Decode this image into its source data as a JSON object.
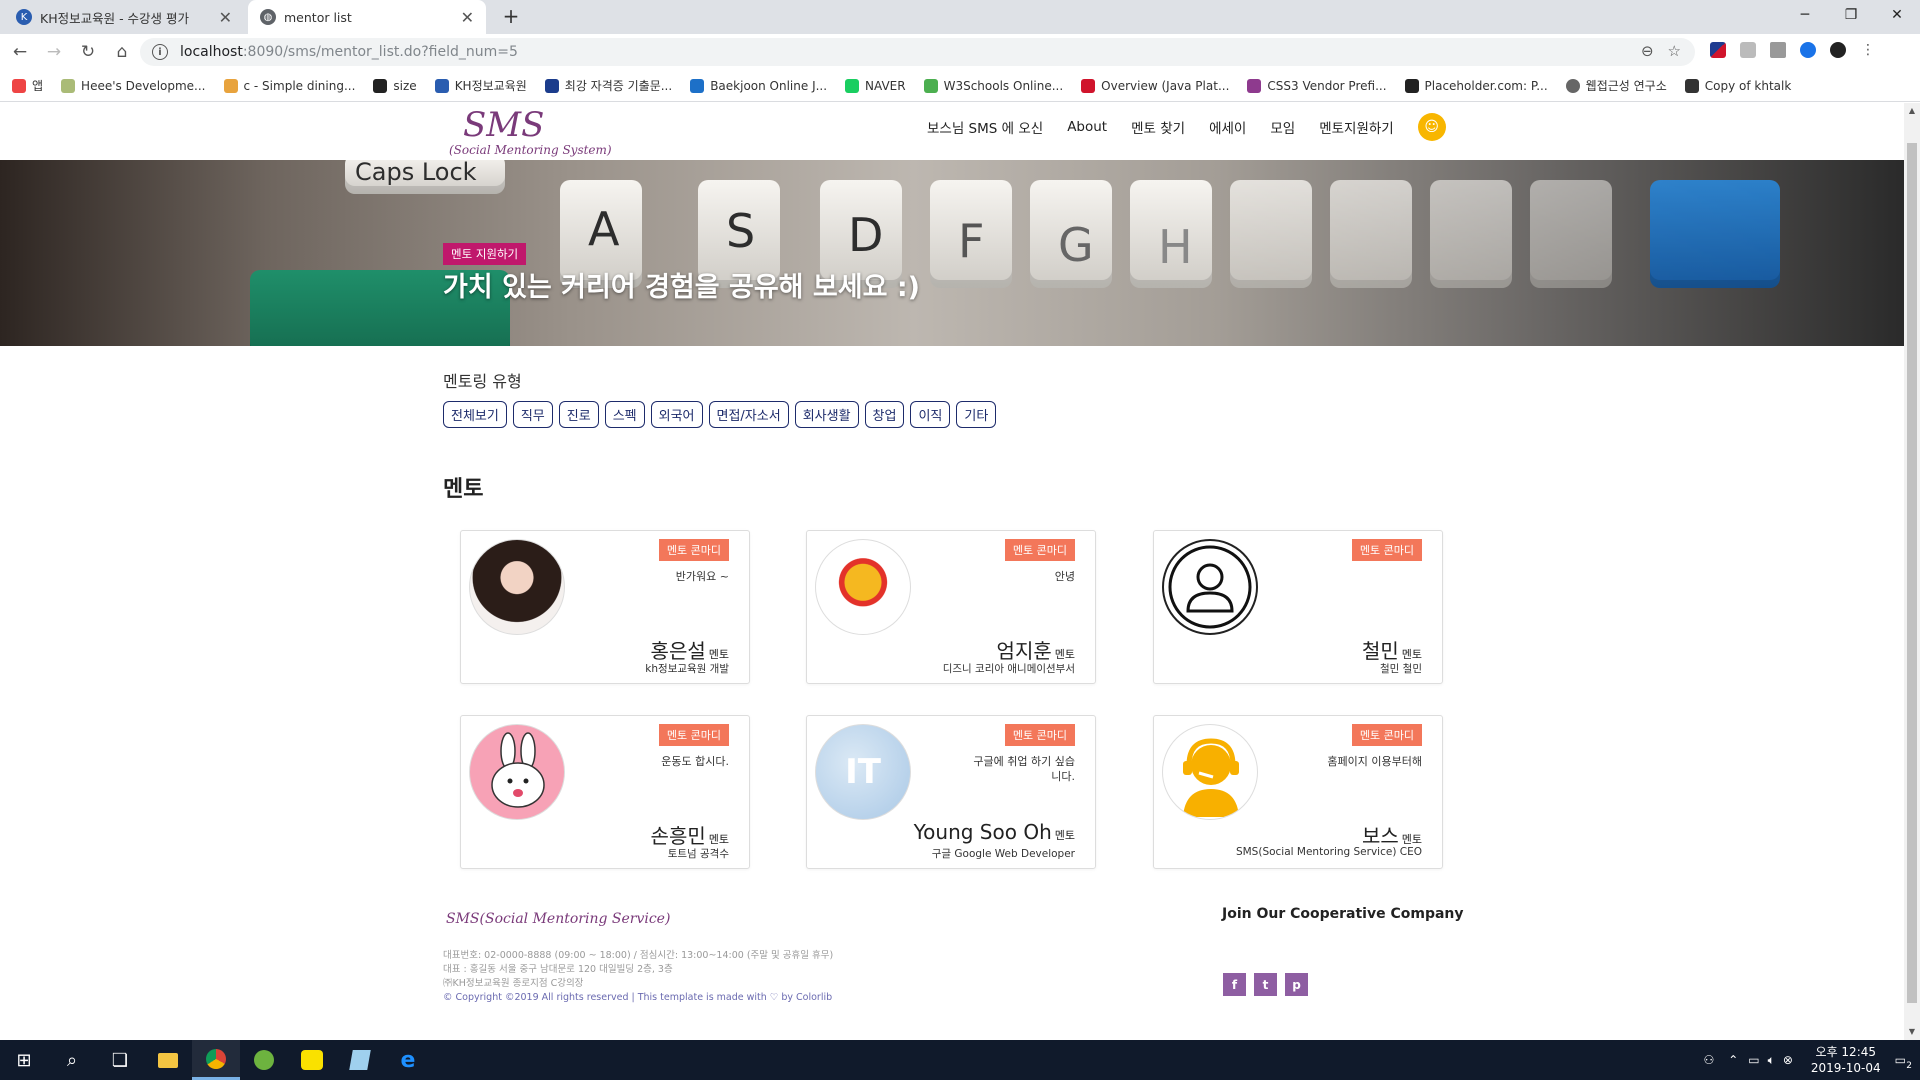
{
  "browser": {
    "tabs": [
      {
        "title": "KH정보교육원 - 수강생 평가",
        "active": false
      },
      {
        "title": "mentor list",
        "active": true
      }
    ],
    "url_host": "localhost",
    "url_rest": ":8090/sms/mentor_list.do?field_num=5",
    "bookmarks": [
      "앱",
      "Heee's Developme...",
      "c - Simple dining...",
      "size",
      "KH정보교육원",
      "최강 자격증 기출문...",
      "Baekjoon Online J...",
      "NAVER",
      "W3Schools Online...",
      "Overview (Java Plat...",
      "CSS3 Vendor Prefi...",
      "Placeholder.com: P...",
      "웹접근성 연구소",
      "Copy of khtalk"
    ]
  },
  "site": {
    "logo_big": "SMS",
    "logo_small": "(Social Mentoring System)",
    "menu": [
      "보스님 SMS 에 오신",
      "About",
      "멘토 찾기",
      "에세이",
      "모임",
      "멘토지원하기"
    ]
  },
  "hero": {
    "badge": "멘토 지원하기",
    "title": "가치 있는 커리어 경험을 공유해 보세요 :)",
    "keys": [
      "Caps Lock",
      "A",
      "S",
      "D",
      "F",
      "G",
      "H"
    ]
  },
  "filter": {
    "heading": "멘토링 유형",
    "types": [
      "전체보기",
      "직무",
      "진로",
      "스펙",
      "외국어",
      "면접/자소서",
      "회사생활",
      "창업",
      "이직",
      "기타"
    ]
  },
  "mentors_heading": "멘토",
  "mentor_badge": "멘토 콘마디",
  "mentor_suffix": "멘토",
  "mentors": [
    {
      "name": "홍은설",
      "msg": "반가워요 ~",
      "org": "kh정보교육원 개발",
      "avatar": "girl-photo"
    },
    {
      "name": "엄지훈",
      "msg": "안녕",
      "org": "디즈니 코리아 애니메이션부서",
      "avatar": "pooh"
    },
    {
      "name": "철민",
      "msg": "",
      "org": "철민 철민",
      "avatar": "default-person"
    },
    {
      "name": "손흥민",
      "msg": "운동도 합시다.",
      "org": "토트넘 공격수",
      "avatar": "bunny"
    },
    {
      "name": "Young Soo Oh",
      "msg": "구글에 취업 하기 싶습니다.",
      "org": "구글 Google Web Developer",
      "avatar": "it"
    },
    {
      "name": "보스",
      "msg": "홈페이지 이용부터해",
      "org": "SMS(Social Mentoring Service) CEO",
      "avatar": "support"
    }
  ],
  "footer": {
    "brand": "SMS(Social Mentoring Service)",
    "line1": "대표번호: 02-0000-8888 (09:00 ~ 18:00) / 점심시간: 13:00~14:00 (주말 및 공휴일 휴무)",
    "line2": "대표 : 홍길동 서울 중구 남대문로 120 대일빌딩 2층, 3층",
    "line3": "㈜KH정보교육원 종로지점 C강의장",
    "line4": "© Copyright ©2019 All rights reserved | This template is made with ♡ by Colorlib",
    "join": "Join Our Cooperative Company",
    "social": [
      "f",
      "t",
      "p"
    ]
  },
  "taskbar": {
    "time": "오후 12:45",
    "date": "2019-10-04",
    "notif": "2"
  },
  "colors": {
    "accent": "#c0186c",
    "badge": "#f3775a",
    "type_border": "#1d2b6b",
    "logo": "#7a3a7a"
  }
}
